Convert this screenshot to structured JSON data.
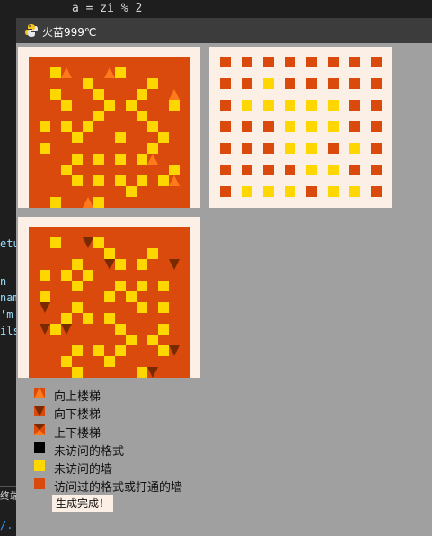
{
  "editor": {
    "code_line": "a = zi % 2",
    "fragments": [
      "etu",
      "n",
      "nam",
      "'m",
      "ils"
    ],
    "bottom_tab": "终端",
    "path_fragment": "/."
  },
  "window": {
    "title": "火苗999℃",
    "icon": "python-snake-icon"
  },
  "colors": {
    "visited": "#d94a0c",
    "wall": "#ffd700",
    "unvisited": "#000000",
    "up": "#ff7a1a",
    "down": "#7a2a00",
    "cream": "#fcf0e6",
    "window_bg": "#a0a0a0"
  },
  "legend": [
    {
      "icon": "stairs-up-icon",
      "label": "向上楼梯"
    },
    {
      "icon": "stairs-down-icon",
      "label": "向下楼梯"
    },
    {
      "icon": "stairs-updown-icon",
      "label": "上下楼梯"
    },
    {
      "icon": "unvisited-cell-icon",
      "label": "未访问的格式"
    },
    {
      "icon": "unvisited-wall-icon",
      "label": "未访问的墙"
    },
    {
      "icon": "visited-cell-icon",
      "label": "访问过的格式或打通的墙"
    }
  ],
  "status": "生成完成！"
}
